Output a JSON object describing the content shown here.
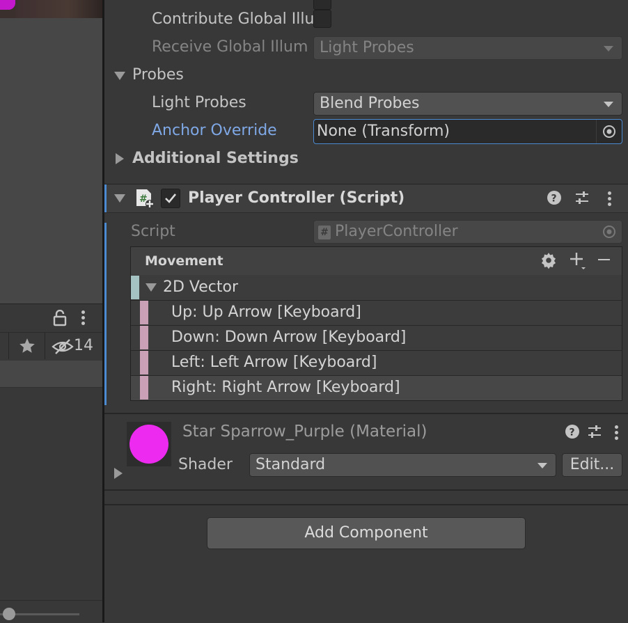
{
  "left_panel": {
    "hidden_count": "14"
  },
  "lighting": {
    "contribute_gi_label": "Contribute Global Illu",
    "receive_gi_label": "Receive Global Illum",
    "receive_gi_value": "Light Probes"
  },
  "probes": {
    "section_label": "Probes",
    "light_probes_label": "Light Probes",
    "light_probes_value": "Blend Probes",
    "anchor_override_label": "Anchor Override",
    "anchor_override_value": "None (Transform)"
  },
  "additional_settings": {
    "label": "Additional Settings"
  },
  "player_controller": {
    "title": "Player Controller (Script)",
    "enabled": true,
    "script_label": "Script",
    "script_value": "PlayerController",
    "action_name": "Movement",
    "composite": "2D Vector",
    "bindings": [
      "Up: Up Arrow [Keyboard]",
      "Down: Down Arrow [Keyboard]",
      "Left: Left Arrow [Keyboard]",
      "Right: Right Arrow [Keyboard]"
    ],
    "selected_binding_index": 3,
    "accent_color": "#4c8ad1"
  },
  "material": {
    "name": "Star Sparrow_Purple (Material)",
    "shader_label": "Shader",
    "shader_value": "Standard",
    "edit_label": "Edit...",
    "preview_color": "#ed2aef"
  },
  "add_component_label": "Add Component"
}
